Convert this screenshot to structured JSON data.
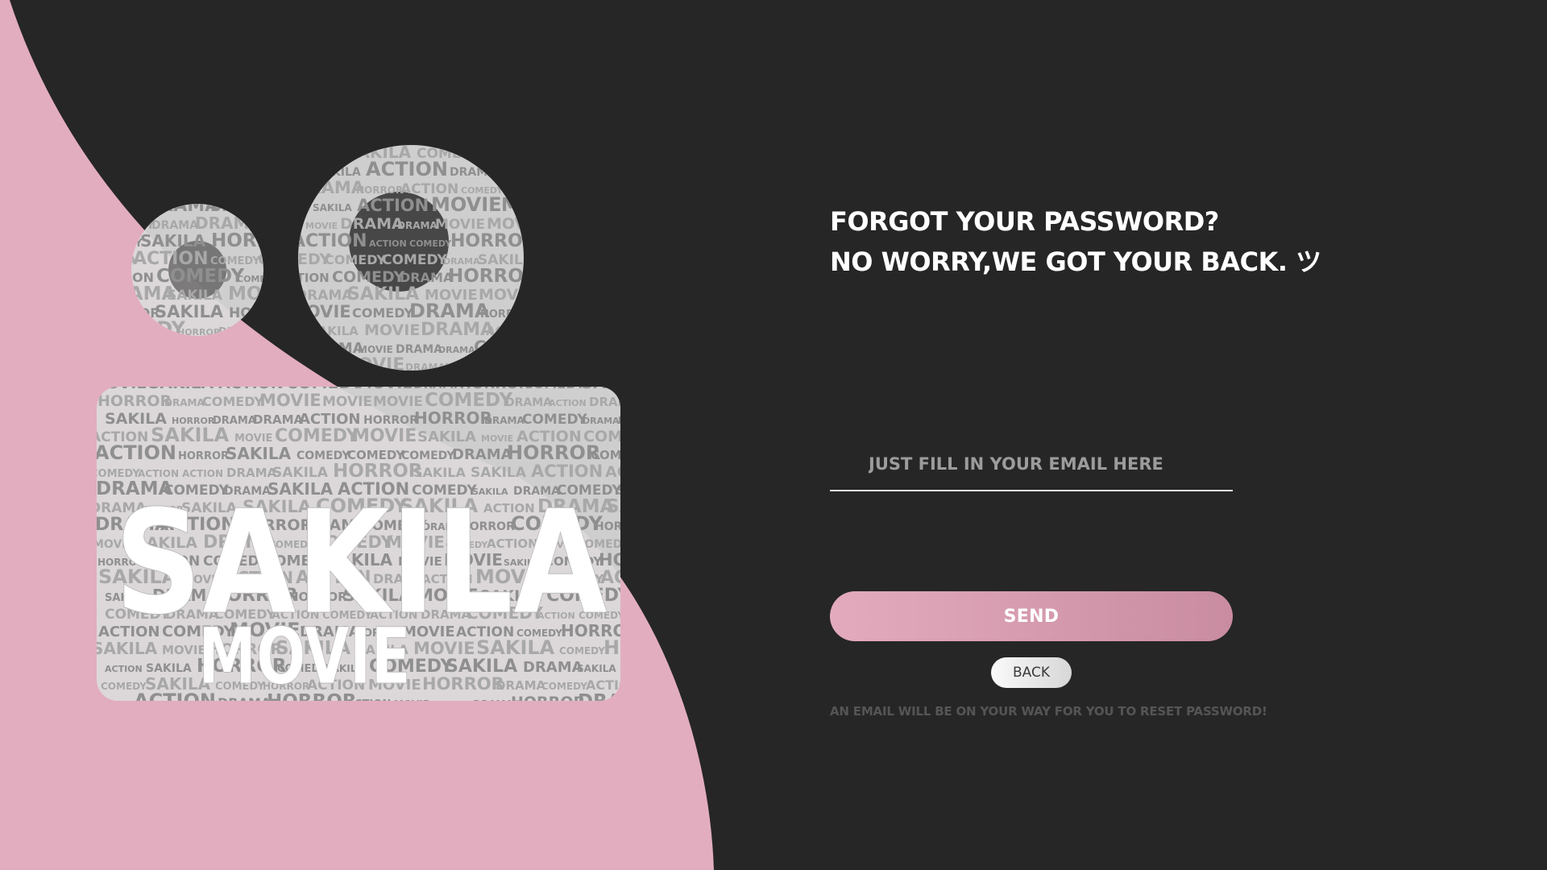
{
  "colors": {
    "background": "#262626",
    "accent_pink": "#e2adbf",
    "button_gradient_start": "#e3aabd",
    "button_gradient_end": "#c98ca0",
    "camera_fill": "#dcdcdc"
  },
  "logo": {
    "main_word": "SAKILA",
    "sub_word": "MOVIE",
    "cloud_words": [
      "COMEDY",
      "ACTION",
      "DRAMA",
      "HORROR",
      "SAKILA",
      "MOVIE"
    ]
  },
  "heading": {
    "line1": "FORGOT YOUR PASSWORD?",
    "line2": "NO WORRY,WE GOT YOUR BACK. ツ"
  },
  "email": {
    "placeholder": "JUST FILL IN YOUR EMAIL HERE",
    "value": ""
  },
  "send_label": "SEND",
  "back_label": "BACK",
  "note": "AN EMAIL WILL BE ON YOUR WAY FOR YOU TO RESET PASSWORD!"
}
